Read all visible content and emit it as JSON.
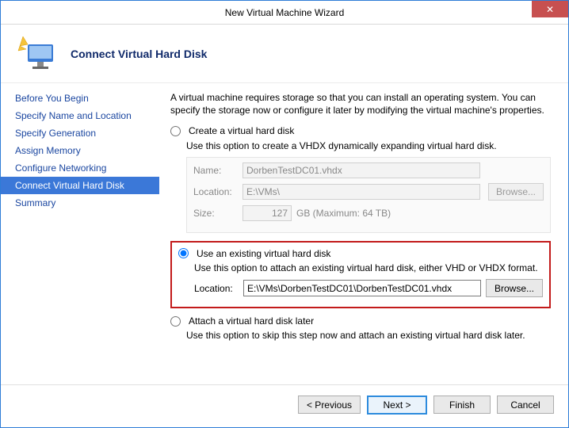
{
  "window": {
    "title": "New Virtual Machine Wizard",
    "close_glyph": "✕"
  },
  "header": {
    "heading": "Connect Virtual Hard Disk"
  },
  "sidebar": {
    "items": [
      {
        "label": "Before You Begin"
      },
      {
        "label": "Specify Name and Location"
      },
      {
        "label": "Specify Generation"
      },
      {
        "label": "Assign Memory"
      },
      {
        "label": "Configure Networking"
      },
      {
        "label": "Connect Virtual Hard Disk"
      },
      {
        "label": "Summary"
      }
    ],
    "selected_index": 5
  },
  "content": {
    "intro": "A virtual machine requires storage so that you can install an operating system. You can specify the storage now or configure it later by modifying the virtual machine's properties.",
    "opt_create": {
      "label": "Create a virtual hard disk",
      "desc": "Use this option to create a VHDX dynamically expanding virtual hard disk.",
      "name_label": "Name:",
      "name_value": "DorbenTestDC01.vhdx",
      "loc_label": "Location:",
      "loc_value": "E:\\VMs\\",
      "browse_label": "Browse...",
      "size_label": "Size:",
      "size_value": "127",
      "size_suffix": "GB (Maximum: 64 TB)"
    },
    "opt_existing": {
      "label": "Use an existing virtual hard disk",
      "desc": "Use this option to attach an existing virtual hard disk, either VHD or VHDX format.",
      "loc_label": "Location:",
      "loc_value": "E:\\VMs\\DorbenTestDC01\\DorbenTestDC01.vhdx",
      "browse_label": "Browse..."
    },
    "opt_later": {
      "label": "Attach a virtual hard disk later",
      "desc": "Use this option to skip this step now and attach an existing virtual hard disk later."
    }
  },
  "footer": {
    "previous": "< Previous",
    "next": "Next >",
    "finish": "Finish",
    "cancel": "Cancel"
  }
}
